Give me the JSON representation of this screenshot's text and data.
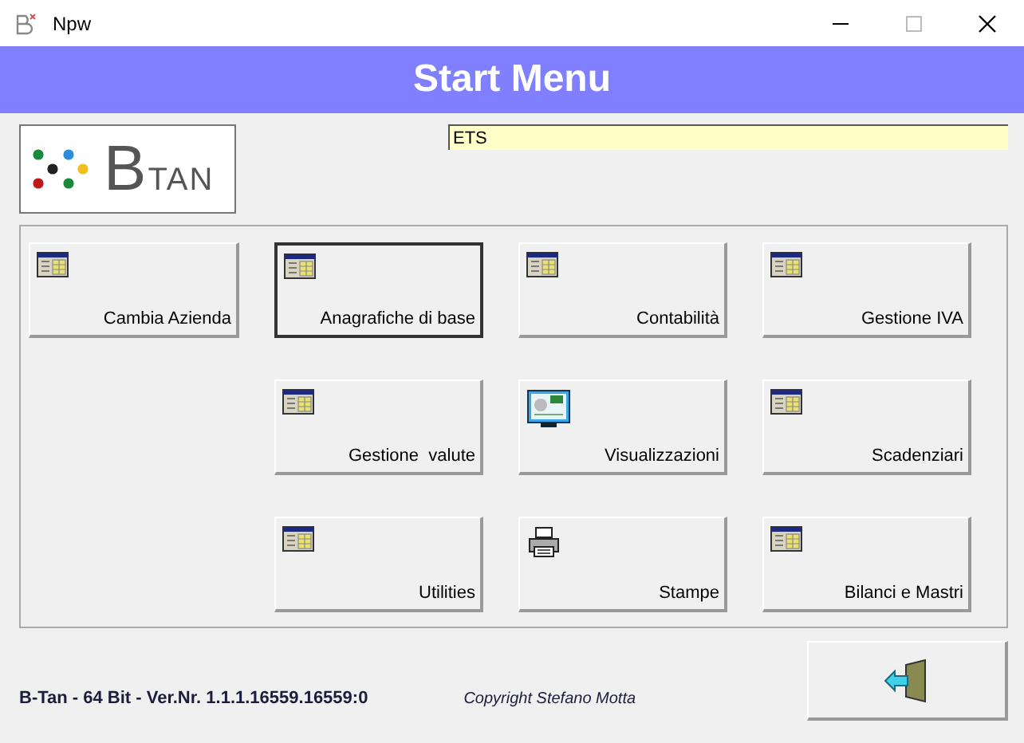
{
  "window": {
    "title": "Npw"
  },
  "header": {
    "title": "Start Menu"
  },
  "logo": {
    "text": "BTAN"
  },
  "company_field": {
    "value": "ETS"
  },
  "menu_rows": [
    [
      {
        "label": "Cambia Azienda",
        "kind": "table",
        "selected": false
      },
      {
        "label": "Anagrafiche di base",
        "kind": "table",
        "selected": true
      },
      {
        "label": "Contabilità",
        "kind": "table",
        "selected": false
      },
      {
        "label": "Gestione IVA",
        "kind": "table",
        "selected": false
      }
    ],
    [
      {
        "label": "Gestione  valute",
        "kind": "table",
        "selected": false
      },
      {
        "label": "Visualizzazioni",
        "kind": "monitor",
        "selected": false
      },
      {
        "label": "Scadenziari",
        "kind": "table",
        "selected": false
      }
    ],
    [
      {
        "label": "Utilities",
        "kind": "table",
        "selected": false
      },
      {
        "label": "Stampe",
        "kind": "printer",
        "selected": false
      },
      {
        "label": "Bilanci e Mastri",
        "kind": "table",
        "selected": false
      }
    ]
  ],
  "footer": {
    "version": "B-Tan - 64 Bit - Ver.Nr. 1.1.1.16559.16559:0",
    "copyright": "Copyright Stefano Motta"
  }
}
